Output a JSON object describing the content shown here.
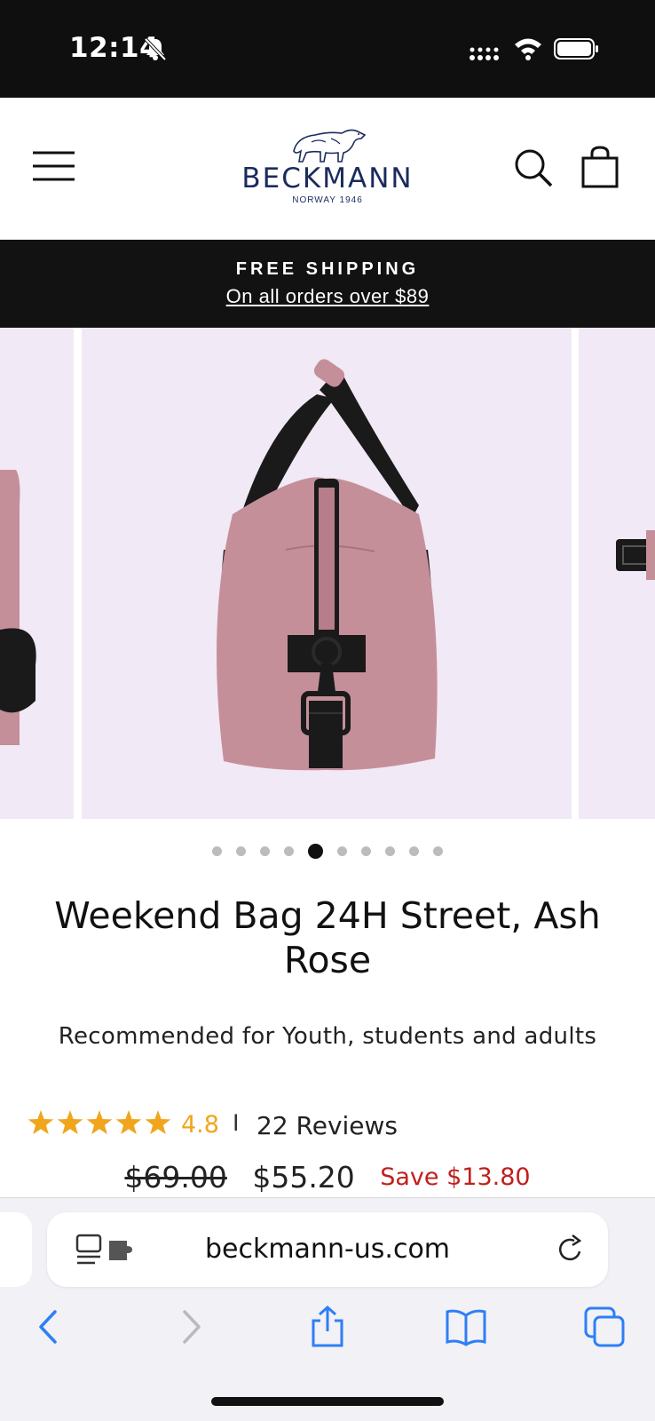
{
  "status_bar": {
    "time": "12:14",
    "icons": [
      "bell-slash-icon",
      "cellular-signal-icon",
      "wifi-icon",
      "battery-icon"
    ]
  },
  "header": {
    "menu_icon": "hamburger-menu-icon",
    "brand_name": "BECKMANN",
    "brand_sub": "NORWAY 1946",
    "search_icon": "search-icon",
    "cart_icon": "shopping-bag-icon"
  },
  "promo": {
    "title": "FREE SHIPPING",
    "link": "On all orders over $89"
  },
  "gallery": {
    "slide_count": 10,
    "active_index": 4,
    "background_color": "#f1e9f5",
    "product_color": "#c58f9a",
    "zoom_icon": "zoom-magnifier-icon"
  },
  "product": {
    "title": "Weekend Bag 24H Street, Ash Rose",
    "recommendation": "Recommended for Youth, students and adults",
    "rating": {
      "stars": 5,
      "value": "4.8",
      "separator": "I",
      "reviews": "22 Reviews",
      "star_color": "#f0a51c"
    },
    "price": {
      "original": "$69.00",
      "current": "$55.20",
      "savings": "Save $13.80",
      "savings_color": "#c0201d"
    }
  },
  "browser": {
    "url": "beckmann-us.com",
    "accent_color": "#2d7ff5",
    "toolbar": [
      "back-icon",
      "forward-icon",
      "share-icon",
      "bookmarks-icon",
      "tabs-icon"
    ]
  }
}
